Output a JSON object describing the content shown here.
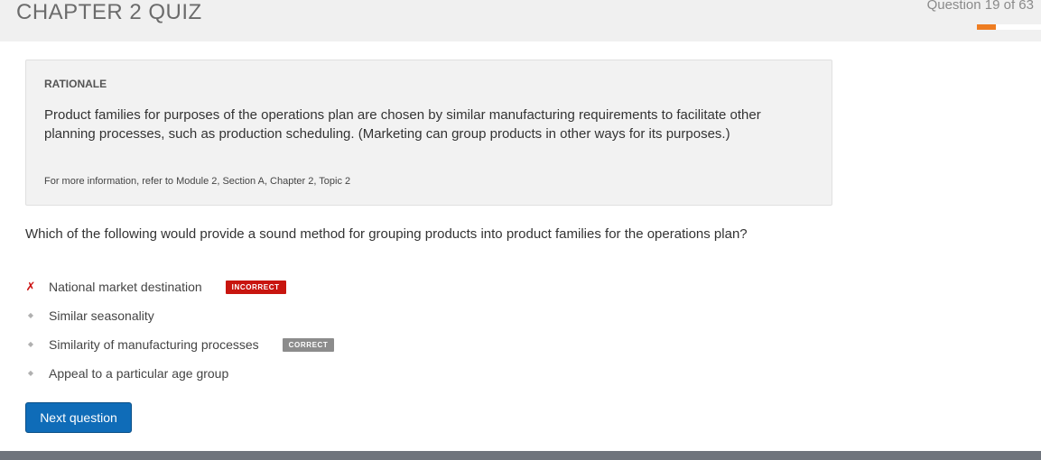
{
  "header": {
    "title": "CHAPTER 2 QUIZ",
    "counter": "Question 19 of 63",
    "progress_fraction": 0.3016
  },
  "rationale": {
    "heading": "RATIONALE",
    "text": "Product families for purposes of the operations plan are chosen by similar manufacturing requirements to facilitate other planning processes, such as production scheduling. (Marketing can group products in other ways for its purposes.)",
    "reference": "For more information, refer to Module 2, Section A, Chapter 2, Topic 2"
  },
  "question": {
    "text": "Which of the following would provide a sound method for grouping products into product families for the operations plan?"
  },
  "answers": [
    {
      "label": "National market destination",
      "marker": "✗",
      "badge": "INCORRECT"
    },
    {
      "label": "Similar seasonality",
      "marker": "◆",
      "badge": ""
    },
    {
      "label": "Similarity of manufacturing processes",
      "marker": "◆",
      "badge": "CORRECT"
    },
    {
      "label": "Appeal to a particular age group",
      "marker": "◆",
      "badge": ""
    }
  ],
  "actions": {
    "next_label": "Next question"
  },
  "colors": {
    "accent": "#0f6cb8",
    "progress": "#ee7d22",
    "incorrect": "#c8150f",
    "correct": "#8c8c8c"
  }
}
